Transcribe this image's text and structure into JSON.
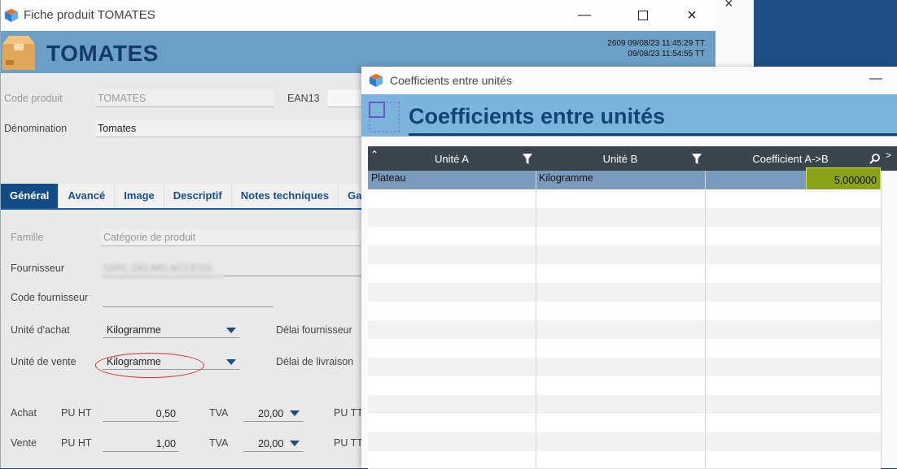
{
  "main_window": {
    "title": "Fiche produit TOMATES",
    "header_title": "TOMATES",
    "meta_line1": "2609  09/08/23 11:45:29  TT",
    "meta_line2": "09/08/23 11:54:55  TT",
    "code_produit_label": "Code produit",
    "code_produit_value": "TOMATES",
    "ean13_label": "EAN13",
    "denomination_label": "Dénomination",
    "denomination_value": "Tomates",
    "tabs": [
      "Général",
      "Avancé",
      "Image",
      "Descriptif",
      "Notes techniques",
      "Gal"
    ],
    "famille_label": "Famille",
    "famille_placeholder": "Catégorie de produit",
    "fournisseur_label": "Fournisseur",
    "fournisseur_value": "SARL DELMO ACCESS",
    "code_fournisseur_label": "Code fournisseur",
    "unite_achat_label": "Unité d'achat",
    "unite_achat_value": "Kilogramme",
    "delai_fournisseur_label": "Délai fournisseur",
    "unite_vente_label": "Unité de vente",
    "unite_vente_value": "Kilogramme",
    "delai_livraison_label": "Délai de livraison",
    "achat_label": "Achat",
    "vente_label": "Vente",
    "pu_ht_label": "PU HT",
    "achat_pu_ht": "0,50",
    "vente_pu_ht": "1,00",
    "tva_label": "TVA",
    "achat_tva": "20,00",
    "vente_tva": "20,00",
    "pu_tt_label": "PU TT"
  },
  "dialog": {
    "title": "Coefficients entre unités",
    "header_title": "Coefficients entre unités",
    "columns": [
      "Unité A",
      "Unité B",
      "Coefficient A->B"
    ],
    "rows": [
      {
        "unite_a": "Plateau",
        "unite_b": "Kilogramme",
        "coefficient": "5,000000"
      }
    ]
  },
  "colors": {
    "header_band": "#6c9fc6",
    "dialog_band": "#7bb5de",
    "grid_header": "#3a454d",
    "selected_row": "#7a9bbd",
    "highlight_cell": "#8aa31a",
    "active_tab": "#124b85"
  }
}
